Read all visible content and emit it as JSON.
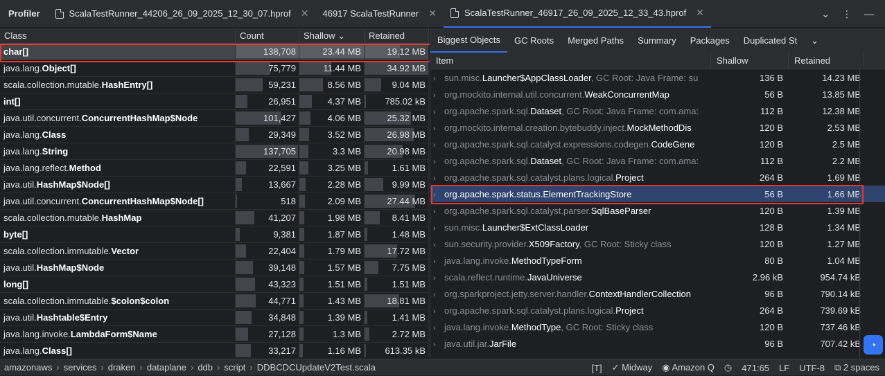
{
  "app_title": "Profiler",
  "tabs": [
    {
      "label": "ScalaTestRunner_44206_26_09_2025_12_30_07.hprof"
    },
    {
      "label": "46917 ScalaTestRunner"
    },
    {
      "label": "ScalaTestRunner_46917_26_09_2025_12_33_43.hprof"
    }
  ],
  "left_table": {
    "headers": {
      "class": "Class",
      "count": "Count",
      "shallow": "Shallow ⌄",
      "retained": "Retained"
    },
    "rows": [
      {
        "pkg": "",
        "cls": "char[]",
        "count": "138,708",
        "shallow": "23.44 MB",
        "retained": "19.12 MB",
        "count_frac": 1.0,
        "shallow_frac": 1.0,
        "retained_frac": 0.55
      },
      {
        "pkg": "java.lang.",
        "cls": "Object[]",
        "count": "75,779",
        "shallow": "11.44 MB",
        "retained": "34.92 MB",
        "count_frac": 0.55,
        "shallow_frac": 0.49,
        "retained_frac": 1.0
      },
      {
        "pkg": "scala.collection.mutable.",
        "cls": "HashEntry[]",
        "count": "59,231",
        "shallow": "8.56 MB",
        "retained": "9.04 MB",
        "count_frac": 0.43,
        "shallow_frac": 0.37,
        "retained_frac": 0.26
      },
      {
        "pkg": "",
        "cls": "int[]",
        "count": "26,951",
        "shallow": "4.37 MB",
        "retained": "785.02 kB",
        "count_frac": 0.19,
        "shallow_frac": 0.19,
        "retained_frac": 0.02
      },
      {
        "pkg": "java.util.concurrent.",
        "cls": "ConcurrentHashMap$Node",
        "count": "101,427",
        "shallow": "4.06 MB",
        "retained": "25.32 MB",
        "count_frac": 0.73,
        "shallow_frac": 0.17,
        "retained_frac": 0.73
      },
      {
        "pkg": "java.lang.",
        "cls": "Class",
        "count": "29,349",
        "shallow": "3.52 MB",
        "retained": "26.98 MB",
        "count_frac": 0.21,
        "shallow_frac": 0.15,
        "retained_frac": 0.77
      },
      {
        "pkg": "java.lang.",
        "cls": "String",
        "count": "137,705",
        "shallow": "3.3 MB",
        "retained": "20.98 MB",
        "count_frac": 0.99,
        "shallow_frac": 0.14,
        "retained_frac": 0.6
      },
      {
        "pkg": "java.lang.reflect.",
        "cls": "Method",
        "count": "22,591",
        "shallow": "3.25 MB",
        "retained": "1.61 MB",
        "count_frac": 0.16,
        "shallow_frac": 0.14,
        "retained_frac": 0.05
      },
      {
        "pkg": "java.util.",
        "cls": "HashMap$Node[]",
        "count": "13,667",
        "shallow": "2.28 MB",
        "retained": "9.99 MB",
        "count_frac": 0.1,
        "shallow_frac": 0.1,
        "retained_frac": 0.29
      },
      {
        "pkg": "java.util.concurrent.",
        "cls": "ConcurrentHashMap$Node[]",
        "count": "518",
        "shallow": "2.09 MB",
        "retained": "27.44 MB",
        "count_frac": 0.0,
        "shallow_frac": 0.09,
        "retained_frac": 0.79
      },
      {
        "pkg": "scala.collection.mutable.",
        "cls": "HashMap",
        "count": "41,207",
        "shallow": "1.98 MB",
        "retained": "8.41 MB",
        "count_frac": 0.3,
        "shallow_frac": 0.08,
        "retained_frac": 0.24
      },
      {
        "pkg": "",
        "cls": "byte[]",
        "count": "9,381",
        "shallow": "1.87 MB",
        "retained": "1.48 MB",
        "count_frac": 0.07,
        "shallow_frac": 0.08,
        "retained_frac": 0.04
      },
      {
        "pkg": "scala.collection.immutable.",
        "cls": "Vector",
        "count": "22,404",
        "shallow": "1.79 MB",
        "retained": "17.72 MB",
        "count_frac": 0.16,
        "shallow_frac": 0.08,
        "retained_frac": 0.51
      },
      {
        "pkg": "java.util.",
        "cls": "HashMap$Node",
        "count": "39,148",
        "shallow": "1.57 MB",
        "retained": "7.75 MB",
        "count_frac": 0.28,
        "shallow_frac": 0.07,
        "retained_frac": 0.22
      },
      {
        "pkg": "",
        "cls": "long[]",
        "count": "43,323",
        "shallow": "1.51 MB",
        "retained": "1.51 MB",
        "count_frac": 0.31,
        "shallow_frac": 0.06,
        "retained_frac": 0.04
      },
      {
        "pkg": "scala.collection.immutable.",
        "cls": "$colon$colon",
        "count": "44,771",
        "shallow": "1.43 MB",
        "retained": "18.81 MB",
        "count_frac": 0.32,
        "shallow_frac": 0.06,
        "retained_frac": 0.54
      },
      {
        "pkg": "java.util.",
        "cls": "Hashtable$Entry",
        "count": "34,848",
        "shallow": "1.39 MB",
        "retained": "1.41 MB",
        "count_frac": 0.25,
        "shallow_frac": 0.06,
        "retained_frac": 0.04
      },
      {
        "pkg": "java.lang.invoke.",
        "cls": "LambdaForm$Name",
        "count": "27,128",
        "shallow": "1.3 MB",
        "retained": "2.72 MB",
        "count_frac": 0.2,
        "shallow_frac": 0.06,
        "retained_frac": 0.08
      },
      {
        "pkg": "java.lang.",
        "cls": "Class[]",
        "count": "33,217",
        "shallow": "1.16 MB",
        "retained": "613.35 kB",
        "count_frac": 0.24,
        "shallow_frac": 0.05,
        "retained_frac": 0.02
      }
    ]
  },
  "right_tabs": [
    "Biggest Objects",
    "GC Roots",
    "Merged Paths",
    "Summary",
    "Packages",
    "Duplicated St"
  ],
  "right_table": {
    "headers": {
      "item": "Item",
      "shallow": "Shallow",
      "retained": "Retained"
    },
    "rows": [
      {
        "pkg": "sun.misc.",
        "cls": "Launcher$AppClassLoader",
        "root": ", GC Root: Java Frame: su",
        "shallow": "136 B",
        "retained": "14.23 MB"
      },
      {
        "pkg": "org.mockito.internal.util.concurrent.",
        "cls": "WeakConcurrentMap",
        "root": "",
        "shallow": "56 B",
        "retained": "13.85 MB"
      },
      {
        "pkg": "org.apache.spark.sql.",
        "cls": "Dataset",
        "root": ", GC Root: Java Frame: com.ama:",
        "shallow": "112 B",
        "retained": "12.38 MB"
      },
      {
        "pkg": "org.mockito.internal.creation.bytebuddy.inject.",
        "cls": "MockMethodDis",
        "root": "",
        "shallow": "120 B",
        "retained": "2.53 MB"
      },
      {
        "pkg": "org.apache.spark.sql.catalyst.expressions.codegen.",
        "cls": "CodeGene",
        "root": "",
        "shallow": "120 B",
        "retained": "2.5 MB"
      },
      {
        "pkg": "org.apache.spark.sql.",
        "cls": "Dataset",
        "root": ", GC Root: Java Frame: com.ama:",
        "shallow": "112 B",
        "retained": "2.2 MB"
      },
      {
        "pkg": "org.apache.spark.sql.catalyst.plans.logical.",
        "cls": "Project",
        "root": "",
        "shallow": "264 B",
        "retained": "1.69 MB"
      },
      {
        "pkg": "org.apache.spark.status.",
        "cls": "ElementTrackingStore",
        "root": "",
        "shallow": "56 B",
        "retained": "1.66 MB"
      },
      {
        "pkg": "org.apache.spark.sql.catalyst.parser.",
        "cls": "SqlBaseParser",
        "root": "",
        "shallow": "120 B",
        "retained": "1.39 MB"
      },
      {
        "pkg": "sun.misc.",
        "cls": "Launcher$ExtClassLoader",
        "root": "",
        "shallow": "128 B",
        "retained": "1.34 MB"
      },
      {
        "pkg": "sun.security.provider.",
        "cls": "X509Factory",
        "root": ", GC Root: Sticky class",
        "shallow": "120 B",
        "retained": "1.27 MB"
      },
      {
        "pkg": "java.lang.invoke.",
        "cls": "MethodTypeForm",
        "root": "",
        "shallow": "80 B",
        "retained": "1.04 MB"
      },
      {
        "pkg": "scala.reflect.runtime.",
        "cls": "JavaUniverse",
        "root": "",
        "shallow": "2.96 kB",
        "retained": "954.74 kB"
      },
      {
        "pkg": "org.sparkproject.jetty.server.handler.",
        "cls": "ContextHandlerCollection",
        "root": "",
        "shallow": "96 B",
        "retained": "790.14 kB"
      },
      {
        "pkg": "org.apache.spark.sql.catalyst.plans.logical.",
        "cls": "Project",
        "root": "",
        "shallow": "264 B",
        "retained": "739.69 kB"
      },
      {
        "pkg": "java.lang.invoke.",
        "cls": "MethodType",
        "root": ", GC Root: Sticky class",
        "shallow": "120 B",
        "retained": "737.46 kB"
      },
      {
        "pkg": "java.util.jar.",
        "cls": "JarFile",
        "root": "",
        "shallow": "96 B",
        "retained": "707.42 kB"
      }
    ]
  },
  "breadcrumbs": [
    "amazonaws",
    "services",
    "draken",
    "dataplane",
    "ddb",
    "script",
    "DDBCDCUpdateV2Test.scala"
  ],
  "status": {
    "midway": "Midway",
    "amazonq": "Amazon Q",
    "position": "471:65",
    "line_sep": "LF",
    "encoding": "UTF-8",
    "indent": "2 spaces"
  }
}
